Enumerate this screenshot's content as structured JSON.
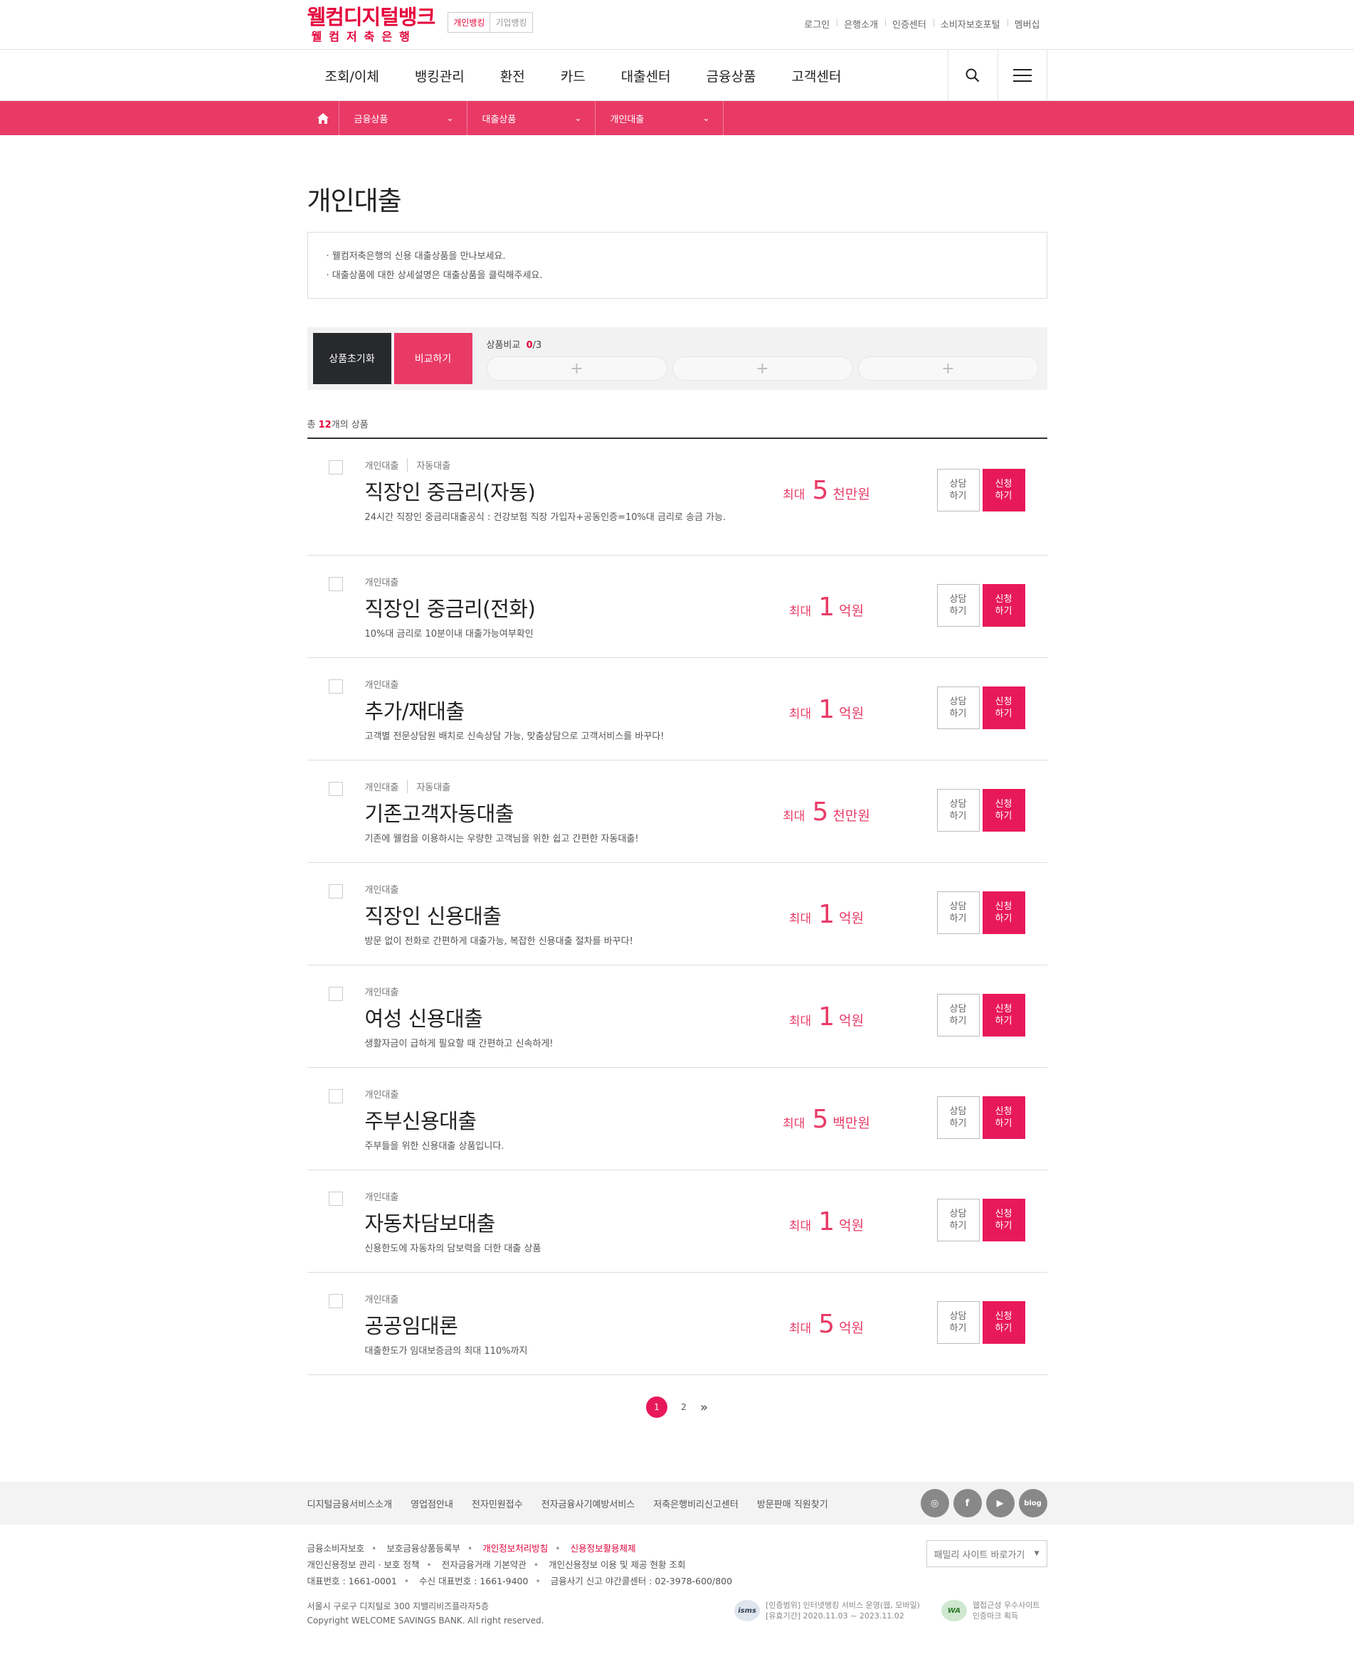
{
  "header": {
    "logo_main": "웰컴디지털뱅크",
    "logo_sub": "웰컴저축은행",
    "bank_tabs": [
      "개인뱅킹",
      "기업뱅킹"
    ],
    "utils": [
      "로그인",
      "은행소개",
      "인증센터",
      "소비자보호포털",
      "멤버십"
    ]
  },
  "gnb": {
    "menu": [
      "조회/이체",
      "뱅킹관리",
      "환전",
      "카드",
      "대출센터",
      "금융상품",
      "고객센터"
    ],
    "icons": [
      "search-icon",
      "menu-icon"
    ]
  },
  "location": {
    "items": [
      "금융상품",
      "대출상품",
      "개인대출"
    ]
  },
  "page": {
    "title": "개인대출",
    "notices": [
      "· 웰컴저축은행의 신용 대출상품을 만나보세요.",
      "· 대출상품에 대한 상세설명은 대출상품을 클릭해주세요."
    ]
  },
  "compare": {
    "reset_label": "상품초기화",
    "compare_label": "비교하기",
    "title": "상품비교",
    "count": "0",
    "max": "/3",
    "slot_symbol": "+"
  },
  "total": {
    "prefix": "총 ",
    "count": "12",
    "suffix": "개의 상품"
  },
  "products": [
    {
      "cats": [
        "개인대출",
        "자동대출"
      ],
      "name": "직장인 중금리(자동)",
      "desc": "24시간 직장인 중금리대출공식 : 건강보험 직장 가입자+공동인증=10%대 금리로 송금 가능.",
      "max_label": "최대",
      "num": "5",
      "unit": "천만원"
    },
    {
      "cats": [
        "개인대출"
      ],
      "name": "직장인 중금리(전화)",
      "desc": "10%대 금리로 10분이내 대출가능여부확인",
      "max_label": "최대",
      "num": "1",
      "unit": "억원"
    },
    {
      "cats": [
        "개인대출"
      ],
      "name": "추가/재대출",
      "desc": "고객별 전문상담원 배치로 신속상담 가능, 맞춤상담으로 고객서비스를 바꾸다!",
      "max_label": "최대",
      "num": "1",
      "unit": "억원"
    },
    {
      "cats": [
        "개인대출",
        "자동대출"
      ],
      "name": "기존고객자동대출",
      "desc": "기존에 웰컴을 이용하시는 우량한 고객님을 위한 쉽고 간편한 자동대출!",
      "max_label": "최대",
      "num": "5",
      "unit": "천만원"
    },
    {
      "cats": [
        "개인대출"
      ],
      "name": "직장인 신용대출",
      "desc": "방문 없이 전화로 간편하게 대출가능, 복잡한 신용대출 절차를 바꾸다!",
      "max_label": "최대",
      "num": "1",
      "unit": "억원"
    },
    {
      "cats": [
        "개인대출"
      ],
      "name": "여성 신용대출",
      "desc": "생활자금이 급하게 필요할 때 간편하고 신속하게!",
      "max_label": "최대",
      "num": "1",
      "unit": "억원"
    },
    {
      "cats": [
        "개인대출"
      ],
      "name": "주부신용대출",
      "desc": "주부들을 위한 신용대출 상품입니다.",
      "max_label": "최대",
      "num": "5",
      "unit": "백만원"
    },
    {
      "cats": [
        "개인대출"
      ],
      "name": "자동차담보대출",
      "desc": "신용한도에 자동차의 담보력을 더한 대출 상품",
      "max_label": "최대",
      "num": "1",
      "unit": "억원"
    },
    {
      "cats": [
        "개인대출"
      ],
      "name": "공공임대론",
      "desc": "대출한도가 임대보증금의 최대 110%까지",
      "max_label": "최대",
      "num": "5",
      "unit": "억원"
    }
  ],
  "buttons": {
    "consult_1": "상담",
    "consult_2": "하기",
    "apply_1": "신청",
    "apply_2": "하기"
  },
  "paging": {
    "pages": [
      "1",
      "2"
    ],
    "current": "1",
    "next": "»"
  },
  "footer": {
    "links": [
      "디지털금융서비스소개",
      "영업점안내",
      "전자민원접수",
      "전자금융사기예방서비스",
      "저축은행비리신고센터",
      "방문판매 직원찾기"
    ],
    "sns": [
      "instagram-icon",
      "facebook-icon",
      "youtube-icon",
      "blog-icon"
    ],
    "sns_labels": [
      "◎",
      "f",
      "▶",
      "blog"
    ],
    "line1": [
      "금융소비자보호",
      "보호금융상품등록부",
      "개인정보처리방침",
      "신용정보활용체제"
    ],
    "line2": [
      "개인신용정보 관리 · 보호 정책",
      "전자금융거래 기본약관",
      "개인신용정보 이용 및 제공 현황 조회"
    ],
    "line3": [
      "대표번호 : 1661-0001",
      "수신 대표번호 : 1661-9400",
      "금융사기 신고 야간콜센터 : 02-3978-600/800"
    ],
    "address": "서울시 구로구 디지털로 300 지밸리비즈플라자5층",
    "copyright": "Copyright WELCOME SAVINGS BANK. All right reserved.",
    "family_site": "패밀리 사이트 바로가기",
    "cert1_logo": "isms",
    "cert1_text1": "[인증범위] 인터넷뱅킹 서비스 운영(웹, 모바일)",
    "cert1_text2": "[유효기간] 2020.11.03 ~ 2023.11.02",
    "cert2_logo": "WA",
    "cert2_text1": "웹접근성 우수사이트",
    "cert2_text2": "인증마크 획득"
  }
}
